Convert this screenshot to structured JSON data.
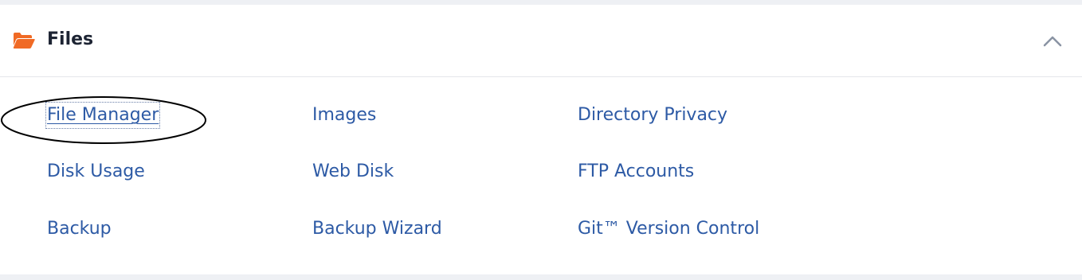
{
  "section": {
    "title": "Files",
    "icon": "folder-open-icon",
    "icon_color": "#f06a25",
    "collapse_icon": "chevron-up-icon"
  },
  "links": {
    "file_manager": "File Manager",
    "images": "Images",
    "directory_privacy": "Directory Privacy",
    "disk_usage": "Disk Usage",
    "web_disk": "Web Disk",
    "ftp_accounts": "FTP Accounts",
    "backup": "Backup",
    "backup_wizard": "Backup Wizard",
    "git_version_control": "Git™ Version Control"
  },
  "colors": {
    "link": "#2d5aa5",
    "title": "#1d2433",
    "accent": "#f06a25"
  }
}
